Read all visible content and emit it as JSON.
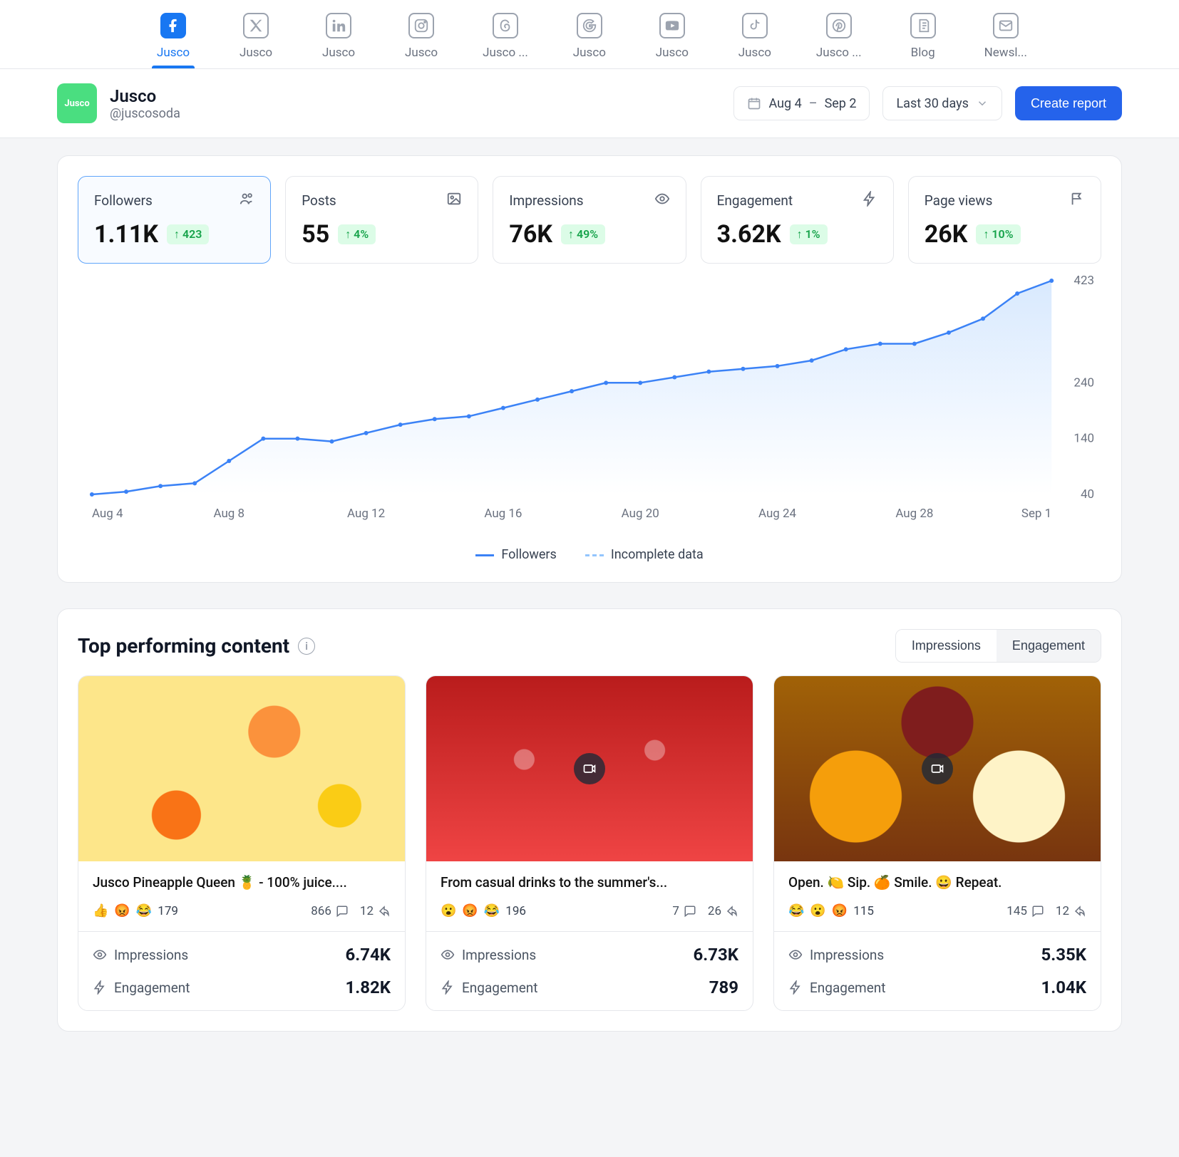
{
  "tabs": [
    {
      "id": "facebook",
      "label": "Jusco",
      "active": true
    },
    {
      "id": "x",
      "label": "Jusco"
    },
    {
      "id": "linkedin",
      "label": "Jusco"
    },
    {
      "id": "instagram",
      "label": "Jusco"
    },
    {
      "id": "threads",
      "label": "Jusco ..."
    },
    {
      "id": "google",
      "label": "Jusco"
    },
    {
      "id": "youtube",
      "label": "Jusco"
    },
    {
      "id": "tiktok",
      "label": "Jusco"
    },
    {
      "id": "pinterest",
      "label": "Jusco ..."
    },
    {
      "id": "blog",
      "label": "Blog"
    },
    {
      "id": "newsletter",
      "label": "Newsl..."
    }
  ],
  "account": {
    "name": "Jusco",
    "handle": "@juscosoda",
    "avatar_text": "Jusco"
  },
  "controls": {
    "date_from": "Aug 4",
    "date_dash": "–",
    "date_to": "Sep 2",
    "range_label": "Last 30 days",
    "create_report": "Create report"
  },
  "stats": [
    {
      "id": "followers",
      "label": "Followers",
      "value": "1.11K",
      "delta": "423",
      "active": true,
      "icon": "users"
    },
    {
      "id": "posts",
      "label": "Posts",
      "value": "55",
      "delta": "4%",
      "icon": "image"
    },
    {
      "id": "impressions",
      "label": "Impressions",
      "value": "76K",
      "delta": "49%",
      "icon": "eye"
    },
    {
      "id": "engagement",
      "label": "Engagement",
      "value": "3.62K",
      "delta": "1%",
      "icon": "zap"
    },
    {
      "id": "pageviews",
      "label": "Page views",
      "value": "26K",
      "delta": "10%",
      "icon": "flag"
    }
  ],
  "chart_data": {
    "type": "line",
    "title": "",
    "xlabel": "",
    "ylabel": "",
    "ylim": [
      40,
      423
    ],
    "y_ticks": [
      40,
      140,
      240,
      423
    ],
    "x_categories": [
      "Aug 4",
      "Aug 8",
      "Aug 12",
      "Aug 16",
      "Aug 20",
      "Aug 24",
      "Aug 28",
      "Sep 1"
    ],
    "series": [
      {
        "name": "Followers",
        "style": "solid",
        "color": "#3b82f6",
        "x_index": [
          0,
          1,
          2,
          3,
          4,
          5,
          6,
          7,
          8,
          9,
          10,
          11,
          12,
          13,
          14,
          15,
          16,
          17,
          18,
          19,
          20,
          21,
          22,
          23,
          24,
          25,
          26,
          27,
          28
        ],
        "values": [
          40,
          45,
          55,
          60,
          100,
          140,
          140,
          135,
          150,
          165,
          175,
          180,
          195,
          210,
          225,
          240,
          240,
          250,
          260,
          265,
          270,
          280,
          300,
          310,
          310,
          330,
          355,
          400,
          423
        ]
      },
      {
        "name": "Incomplete data",
        "style": "dashed",
        "color": "#93c5fd",
        "x_index": [],
        "values": []
      }
    ],
    "legend": [
      "Followers",
      "Incomplete data"
    ]
  },
  "top_content": {
    "title": "Top performing content",
    "segments": {
      "impressions": "Impressions",
      "engagement": "Engagement",
      "active": "impressions"
    },
    "labels": {
      "impressions": "Impressions",
      "engagement": "Engagement"
    },
    "posts": [
      {
        "title": "Jusco Pineapple Queen 🍍 - 100% juice....",
        "reactions": {
          "emojis": [
            "👍",
            "😡",
            "😂"
          ],
          "count": "179"
        },
        "comments": "866",
        "shares": "12",
        "impressions": "6.74K",
        "engagement": "1.82K",
        "video": false,
        "bg": "bg1"
      },
      {
        "title": "From casual drinks to the summer's...",
        "reactions": {
          "emojis": [
            "😮",
            "😡",
            "😂"
          ],
          "count": "196"
        },
        "comments": "7",
        "shares": "26",
        "impressions": "6.73K",
        "engagement": "789",
        "video": true,
        "bg": "bg2"
      },
      {
        "title": "Open. 🍋 Sip. 🍊 Smile. 😀 Repeat.",
        "reactions": {
          "emojis": [
            "😂",
            "😮",
            "😡"
          ],
          "count": "115"
        },
        "comments": "145",
        "shares": "12",
        "impressions": "5.35K",
        "engagement": "1.04K",
        "video": true,
        "bg": "bg3"
      }
    ]
  }
}
